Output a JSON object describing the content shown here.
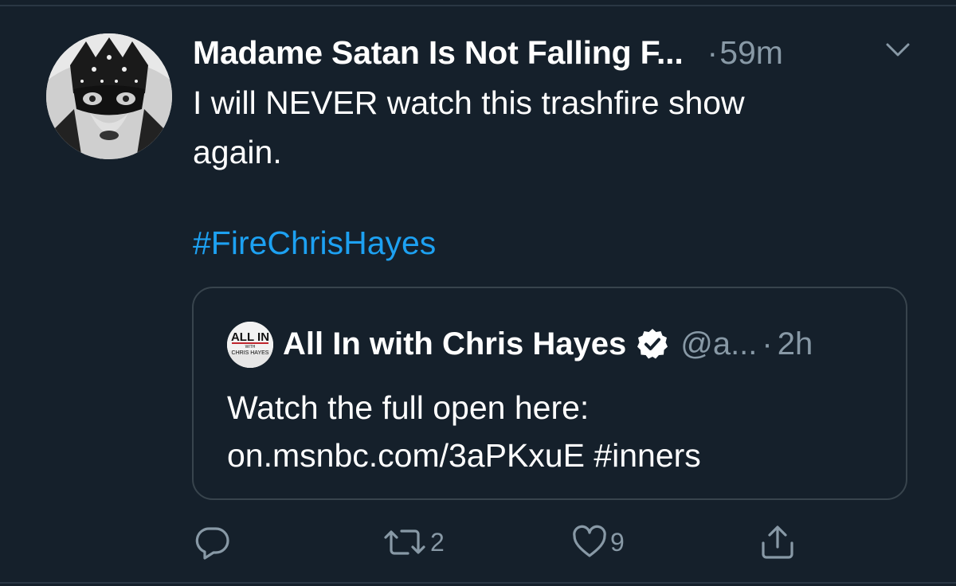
{
  "tweet": {
    "display_name": "Madame Satan Is Not Falling F...",
    "dot": "·",
    "time": "59m",
    "text_line1": "I will NEVER watch this trashfire show",
    "text_line2": "again.",
    "hashtag": "#FireChrisHayes"
  },
  "quoted": {
    "logo_text_top": "ALL IN",
    "logo_text_mid": "WITH",
    "logo_text_bottom": "CHRIS HAYES",
    "display_name": "All In with Chris Hayes",
    "handle": "@a...",
    "dot": "·",
    "time": "2h",
    "text_line1": "Watch the full open here:",
    "text_line2": "on.msnbc.com/3aPKxuE #inners"
  },
  "actions": {
    "reply_count": "",
    "retweet_count": "2",
    "like_count": "9"
  },
  "colors": {
    "background": "#15202b",
    "text": "#ffffff",
    "secondary": "#8899a6",
    "link": "#1da1f2",
    "border": "#38444d"
  },
  "icons": [
    "reply-icon",
    "retweet-icon",
    "like-icon",
    "share-icon",
    "chevron-down-icon",
    "verified-badge-icon"
  ]
}
